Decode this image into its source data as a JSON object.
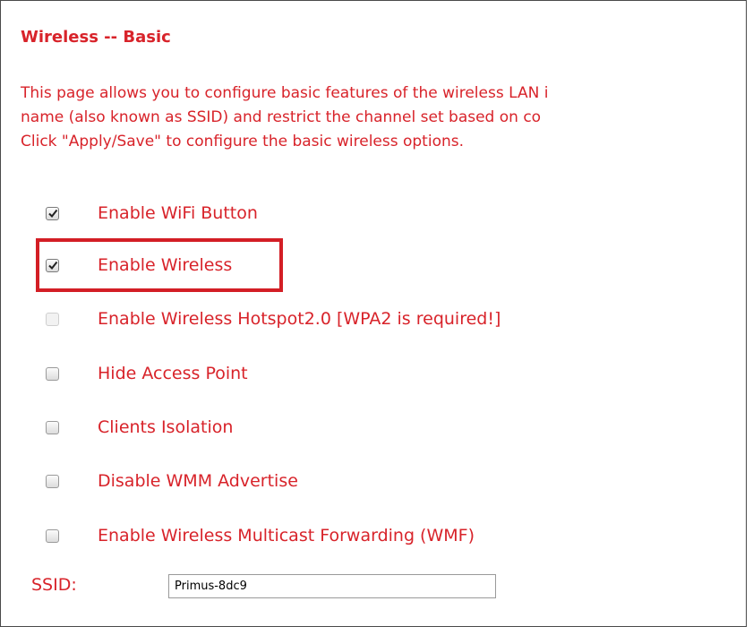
{
  "page": {
    "title": "Wireless -- Basic",
    "description_lines": [
      "This page allows you to configure basic features of the wireless LAN i",
      "name (also known as SSID) and restrict the channel set based on co",
      "Click \"Apply/Save\" to configure the basic wireless options."
    ]
  },
  "options": [
    {
      "label": "Enable WiFi Button",
      "checked": true,
      "disabled": false
    },
    {
      "label": "Enable Wireless",
      "checked": true,
      "disabled": false,
      "highlighted": true
    },
    {
      "label": "Enable Wireless Hotspot2.0 [WPA2 is required!]",
      "checked": false,
      "disabled": true
    },
    {
      "label": "Hide Access Point",
      "checked": false,
      "disabled": false
    },
    {
      "label": "Clients Isolation",
      "checked": false,
      "disabled": false
    },
    {
      "label": "Disable WMM Advertise",
      "checked": false,
      "disabled": false
    },
    {
      "label": "Enable Wireless Multicast Forwarding (WMF)",
      "checked": false,
      "disabled": false
    }
  ],
  "ssid": {
    "label": "SSID:",
    "value": "Primus-8dc9"
  },
  "colors": {
    "text": "#d8232a",
    "highlight_box": "#d31e25"
  }
}
